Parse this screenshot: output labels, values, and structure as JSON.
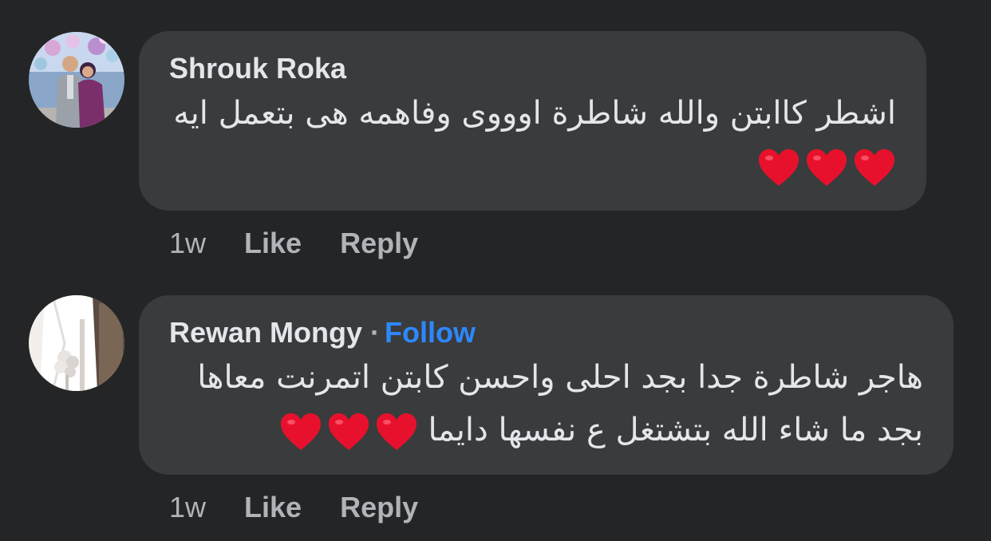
{
  "comments": [
    {
      "author": "Shrouk Roka",
      "text_lines": [
        "اشطر كاابتن والله شاطرة اوووى وفاهمه هى بتعمل ايه"
      ],
      "emoji": "❤️❤️❤️",
      "time": "1w",
      "like_label": "Like",
      "reply_label": "Reply"
    },
    {
      "author": "Rewan Mongy",
      "separator": "·",
      "follow_label": "Follow",
      "text_lines": [
        "هاجر شاطرة جدا بجد احلى واحسن كابتن اتمرنت معاها",
        "بجد ما شاء الله بتشتغل ع نفسها دايما"
      ],
      "emoji": "❤️❤️❤️",
      "time": "1w",
      "like_label": "Like",
      "reply_label": "Reply"
    }
  ],
  "colors": {
    "background": "#242526",
    "bubble": "#3a3b3c",
    "primary_text": "#e4e6eb",
    "secondary_text": "#b0b3b8",
    "follow": "#2d88ff",
    "heart": "#e8112d"
  }
}
